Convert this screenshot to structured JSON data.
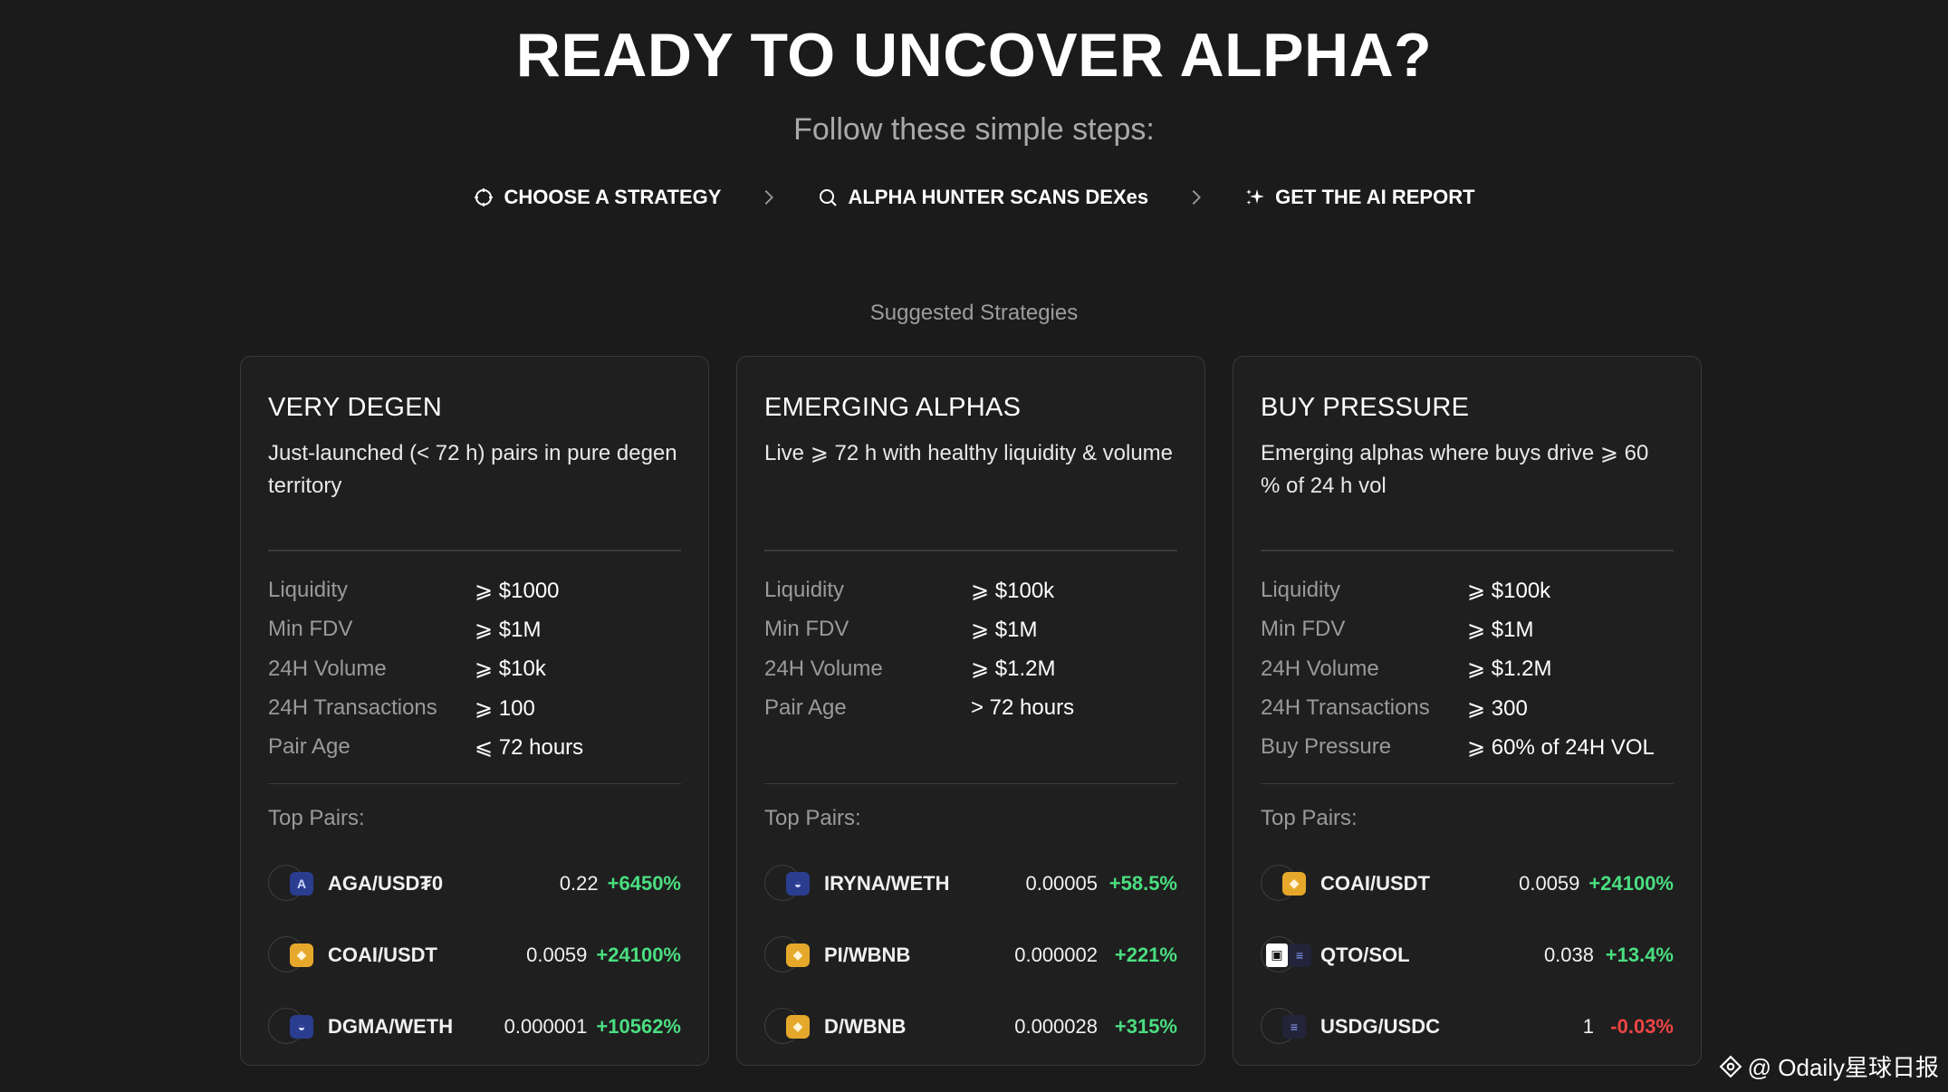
{
  "hero": {
    "title": "READY TO UNCOVER ALPHA?",
    "subtitle": "Follow these simple steps:"
  },
  "steps": [
    {
      "label": "CHOOSE A STRATEGY",
      "icon": "crosshair-icon"
    },
    {
      "label": "ALPHA HUNTER SCANS DEXes",
      "icon": "search-icon"
    },
    {
      "label": "GET THE AI REPORT",
      "icon": "sparkle-icon"
    }
  ],
  "section_label": "Suggested Strategies",
  "cards": [
    {
      "title": "VERY DEGEN",
      "description": "Just-launched (< 72 h) pairs in pure degen territory",
      "criteria": [
        {
          "label": "Liquidity",
          "value": "⩾ $1000"
        },
        {
          "label": "Min FDV",
          "value": "⩾ $1M"
        },
        {
          "label": "24H Volume",
          "value": "⩾ $10k"
        },
        {
          "label": "24H Transactions",
          "value": "⩾ 100"
        },
        {
          "label": "Pair Age",
          "value": "⩽ 72 hours"
        }
      ],
      "top_pairs_label": "Top Pairs:",
      "pairs": [
        {
          "name": "AGA/USD₮0",
          "price": "0.22",
          "change": "+6450%",
          "icon": "agora-token-icon"
        },
        {
          "name": "COAI/USDT",
          "price": "0.0059",
          "change": "+24100%",
          "icon": "bnb-chain-icon"
        },
        {
          "name": "DGMA/WETH",
          "price": "0.000001",
          "change": "+10562%",
          "icon": "base-chain-icon"
        }
      ]
    },
    {
      "title": "EMERGING ALPHAS",
      "description": "Live ⩾ 72 h with healthy liquidity & volume",
      "criteria": [
        {
          "label": "Liquidity",
          "value": "⩾ $100k"
        },
        {
          "label": "Min FDV",
          "value": "⩾ $1M"
        },
        {
          "label": "24H Volume",
          "value": "⩾ $1.2M"
        },
        {
          "label": "Pair Age",
          "value": "> 72 hours"
        }
      ],
      "top_pairs_label": "Top Pairs:",
      "pairs": [
        {
          "name": "IRYNA/WETH",
          "price": "0.00005",
          "change": "+58.5%",
          "icon": "base-chain-icon"
        },
        {
          "name": "PI/WBNB",
          "price": "0.000002",
          "change": "+221%",
          "icon": "bnb-chain-icon"
        },
        {
          "name": "D/WBNB",
          "price": "0.000028",
          "change": "+315%",
          "icon": "bnb-chain-icon"
        }
      ]
    },
    {
      "title": "BUY PRESSURE",
      "description": "Emerging alphas where buys drive ⩾ 60 % of 24 h vol",
      "criteria": [
        {
          "label": "Liquidity",
          "value": "⩾ $100k"
        },
        {
          "label": "Min FDV",
          "value": "⩾ $1M"
        },
        {
          "label": "24H Volume",
          "value": "⩾ $1.2M"
        },
        {
          "label": "24H Transactions",
          "value": "⩾ 300"
        },
        {
          "label": "Buy Pressure",
          "value": "⩾ 60% of 24H VOL"
        }
      ],
      "top_pairs_label": "Top Pairs:",
      "pairs": [
        {
          "name": "COAI/USDT",
          "price": "0.0059",
          "change": "+24100%",
          "icon": "bnb-chain-icon"
        },
        {
          "name": "QTO/SOL",
          "price": "0.038",
          "change": "+13.4%",
          "icon": "solana-chain-icon"
        },
        {
          "name": "USDG/USDC",
          "price": "1",
          "change": "-0.03%",
          "icon": "solana-chain-icon"
        }
      ]
    }
  ],
  "watermark": "@ Odaily星球日报",
  "colors": {
    "background": "#1b1b1b",
    "positive": "#4ade80",
    "negative": "#ef4444",
    "muted": "#9a9a9a"
  }
}
